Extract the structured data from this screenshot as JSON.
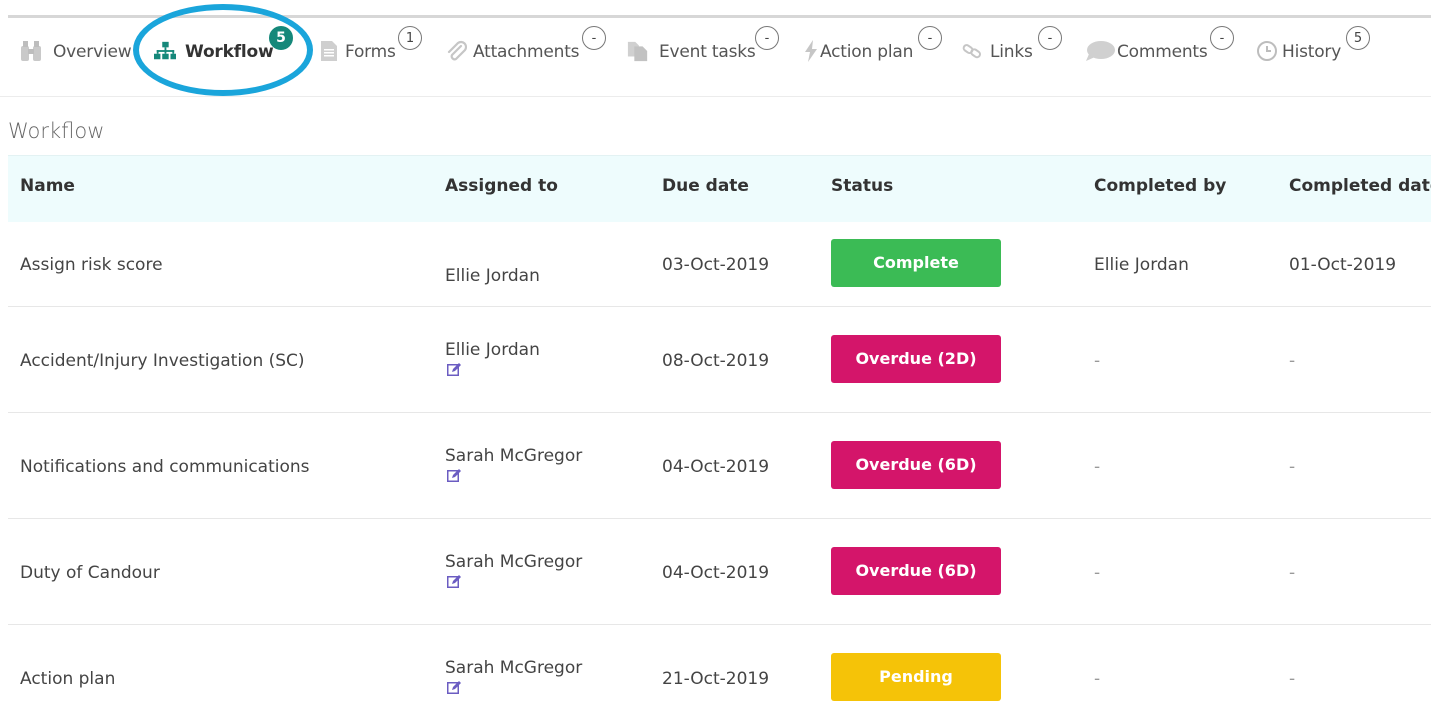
{
  "tabs": [
    {
      "label": "Overview",
      "count": null,
      "icon": "binoculars-icon"
    },
    {
      "label": "Workflow",
      "count": "5",
      "icon": "sitemap-icon",
      "active": true
    },
    {
      "label": "Forms",
      "count": "1",
      "icon": "document-icon"
    },
    {
      "label": "Attachments",
      "count": "-",
      "icon": "paperclip-icon"
    },
    {
      "label": "Event tasks",
      "count": "-",
      "icon": "copy-icon"
    },
    {
      "label": "Action plan",
      "count": "-",
      "icon": "bolt-icon"
    },
    {
      "label": "Links",
      "count": "-",
      "icon": "link-icon"
    },
    {
      "label": "Comments",
      "count": "-",
      "icon": "comment-icon"
    },
    {
      "label": "History",
      "count": "5",
      "icon": "clock-icon"
    }
  ],
  "section": {
    "title": "Workflow"
  },
  "table": {
    "columns": [
      "Name",
      "Assigned to",
      "Due date",
      "Status",
      "Completed by",
      "Completed date"
    ],
    "rows": [
      {
        "name": "Assign risk score",
        "assigned": "Ellie Jordan",
        "due": "03-Oct-2019",
        "status": "Complete",
        "completed_by": "Ellie Jordan",
        "completed_date": "01-Oct-2019"
      },
      {
        "name": "Accident/Injury Investigation (SC)",
        "assigned": "Ellie Jordan",
        "due": "08-Oct-2019",
        "status": "Overdue (2D)",
        "completed_by": "-",
        "completed_date": "-"
      },
      {
        "name": "Notifications and communications",
        "assigned": "Sarah McGregor",
        "due": "04-Oct-2019",
        "status": "Overdue (6D)",
        "completed_by": "-",
        "completed_date": "-"
      },
      {
        "name": "Duty of Candour",
        "assigned": "Sarah McGregor",
        "due": "04-Oct-2019",
        "status": "Overdue (6D)",
        "completed_by": "-",
        "completed_date": "-"
      },
      {
        "name": "Action plan",
        "assigned": "Sarah McGregor",
        "due": "21-Oct-2019",
        "status": "Pending",
        "completed_by": "-",
        "completed_date": "-"
      }
    ]
  },
  "colors": {
    "accent": "#15887a",
    "highlight": "#1aa5db",
    "status_complete": "#3bbb55",
    "status_overdue": "#d4156a",
    "status_pending": "#f5c308",
    "header_bg": "#eefcfd",
    "edit_icon": "#6b5cc2"
  }
}
